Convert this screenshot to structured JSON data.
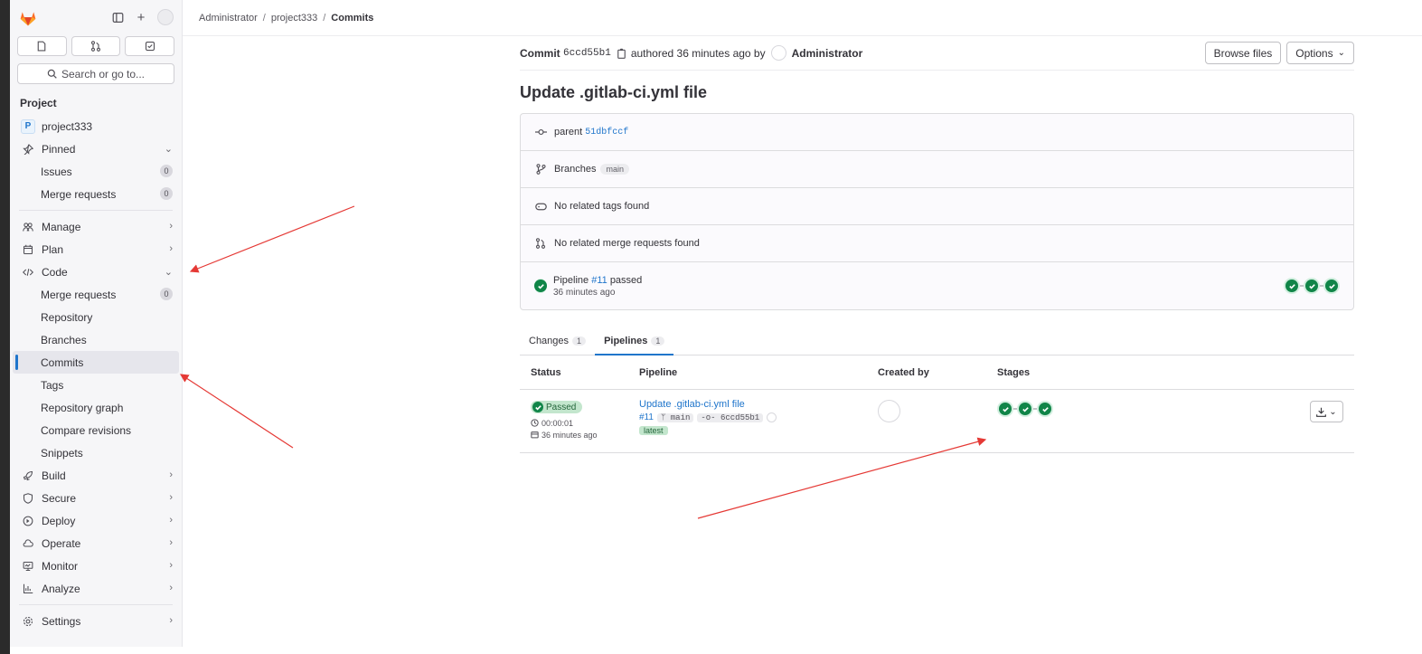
{
  "breadcrumb": [
    "Administrator",
    "project333",
    "Commits"
  ],
  "sidebar": {
    "search_placeholder": "Search or go to...",
    "section_title": "Project",
    "project_name": "project333",
    "project_initial": "P",
    "items": [
      {
        "label": "Pinned"
      },
      {
        "label": "Issues",
        "count": "0"
      },
      {
        "label": "Merge requests",
        "count": "0"
      },
      {
        "label": "Manage"
      },
      {
        "label": "Plan"
      },
      {
        "label": "Code"
      },
      {
        "label": "Merge requests",
        "count": "0"
      },
      {
        "label": "Repository"
      },
      {
        "label": "Branches"
      },
      {
        "label": "Commits"
      },
      {
        "label": "Tags"
      },
      {
        "label": "Repository graph"
      },
      {
        "label": "Compare revisions"
      },
      {
        "label": "Snippets"
      },
      {
        "label": "Build"
      },
      {
        "label": "Secure"
      },
      {
        "label": "Deploy"
      },
      {
        "label": "Operate"
      },
      {
        "label": "Monitor"
      },
      {
        "label": "Analyze"
      },
      {
        "label": "Settings"
      }
    ]
  },
  "commit": {
    "label": "Commit",
    "sha": "6ccd55b1",
    "authored": "authored 36 minutes ago by",
    "author": "Administrator",
    "browse_files": "Browse files",
    "options": "Options",
    "title": "Update .gitlab-ci.yml file",
    "parent_label": "parent",
    "parent_sha": "51dbfccf",
    "branches_label": "Branches",
    "branch": "main",
    "no_tags": "No related tags found",
    "no_mrs": "No related merge requests found",
    "pipeline_prefix": "Pipeline",
    "pipeline_id": "#11",
    "pipeline_status": "passed",
    "pipeline_time": "36 minutes ago"
  },
  "tabs": [
    {
      "label": "Changes",
      "count": "1"
    },
    {
      "label": "Pipelines",
      "count": "1"
    }
  ],
  "table": {
    "headers": [
      "Status",
      "Pipeline",
      "Created by",
      "Stages"
    ],
    "row": {
      "status": "Passed",
      "duration": "00:00:01",
      "finished": "36 minutes ago",
      "title": "Update .gitlab-ci.yml file",
      "id": "#11",
      "ref": "main",
      "sha": "6ccd55b1",
      "tag": "latest"
    }
  },
  "colors": {
    "accent": "#1f75cb",
    "success": "#108548",
    "annotation_arrow": "#e53935"
  }
}
